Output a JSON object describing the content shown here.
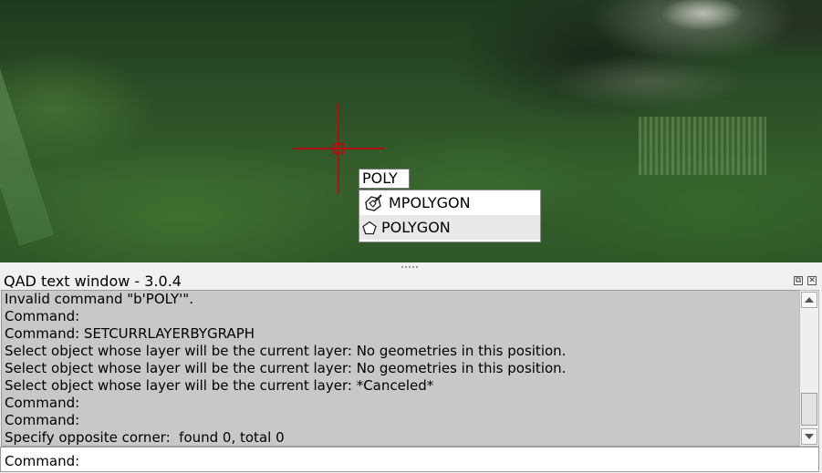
{
  "dynamic_input": {
    "value": "POLY"
  },
  "autocomplete": {
    "items": [
      {
        "label": "MPOLYGON",
        "icon": "mpolygon-icon"
      },
      {
        "label": "POLYGON",
        "icon": "polygon-icon"
      }
    ]
  },
  "text_window": {
    "title": "QAD text window - 3.0.4",
    "history": [
      "Invalid command \"b'POLY'\".",
      "Command:",
      "Command: SETCURRLAYERBYGRAPH",
      "Select object whose layer will be the current layer: No geometries in this position.",
      "Select object whose layer will be the current layer: No geometries in this position.",
      "Select object whose layer will be the current layer: *Canceled*",
      "Command:",
      "Command:",
      "Specify opposite corner:  found 0, total 0"
    ],
    "prompt": "Command:",
    "input_value": ""
  },
  "colors": {
    "crosshair": "#b01010",
    "history_bg": "#c8c8c8"
  }
}
